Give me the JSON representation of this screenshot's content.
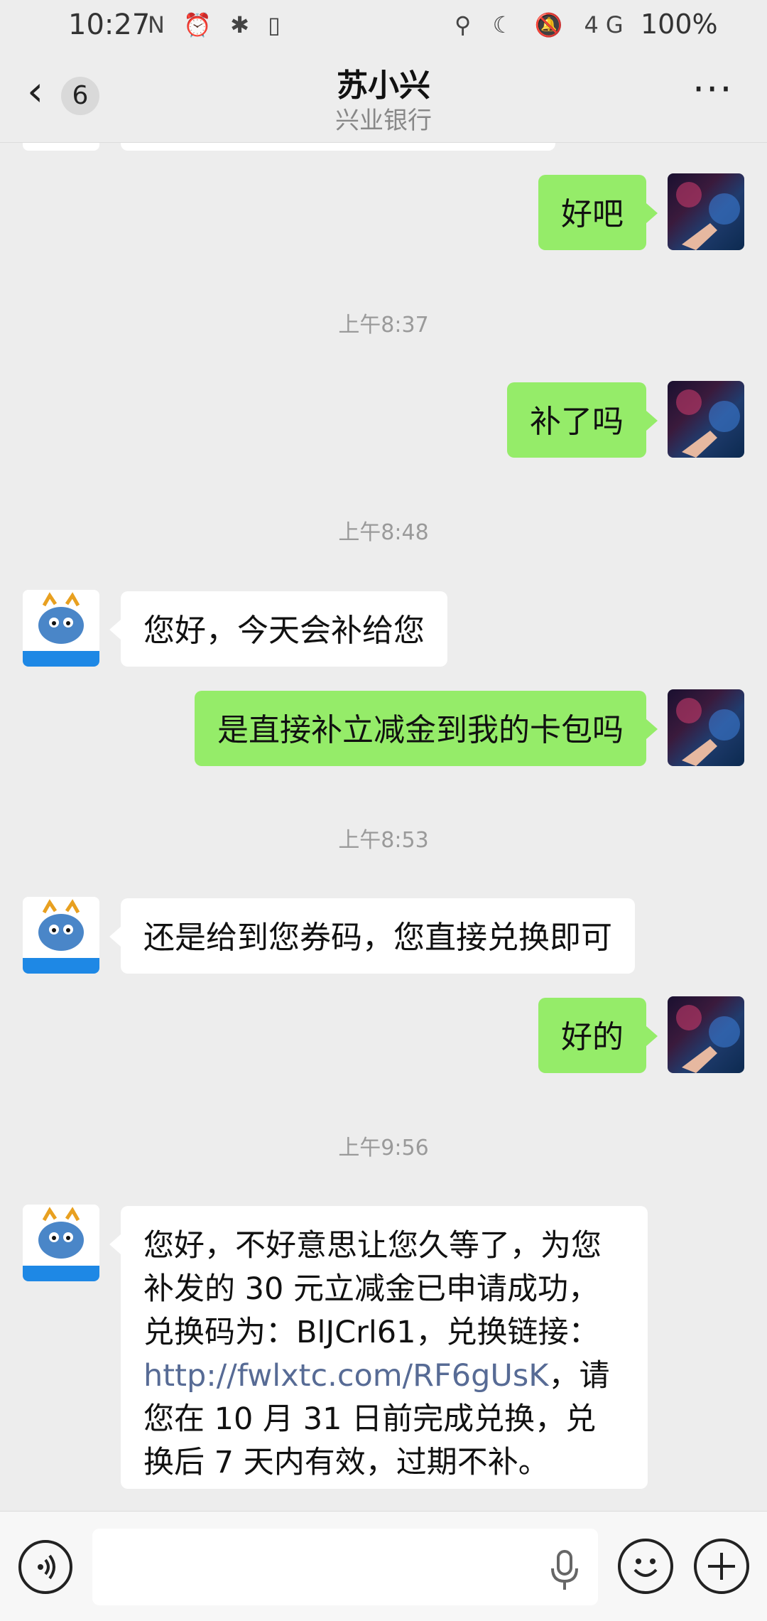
{
  "status_bar": {
    "time": "10:27",
    "left_icons": "N ⏰ ✱ ▯",
    "right_icons": "⚲ ☾ 🔕 4G",
    "battery": "100%"
  },
  "header": {
    "unread_count": "6",
    "title": "苏小兴",
    "subtitle": "兴业银行"
  },
  "messages": {
    "m1": "好吧",
    "t1": "上午8:37",
    "m2": "补了吗",
    "t2": "上午8:48",
    "m3": "您好，今天会补给您",
    "m4": "是直接补立减金到我的卡包吗",
    "t3": "上午8:53",
    "m5": "还是给到您券码，您直接兑换即可",
    "m6": "好的",
    "t4": "上午9:56",
    "m7_part1": "您好，不好意思让您久等了，为您补发的 30 元立减金已申请成功，兑换码为：BlJCrl61，兑换链接：",
    "m7_link": "http://fwlxtc.com/RF6gUsK",
    "m7_part2": "，请您在 10 月 31 日前完成兑换，兑换后 7 天内有效，过期不补。"
  },
  "bank_logo_text": "兴业银行",
  "colors": {
    "sent_bubble": "#95ec69",
    "received_bubble": "#ffffff",
    "link": "#576b95",
    "background": "#ededed"
  }
}
